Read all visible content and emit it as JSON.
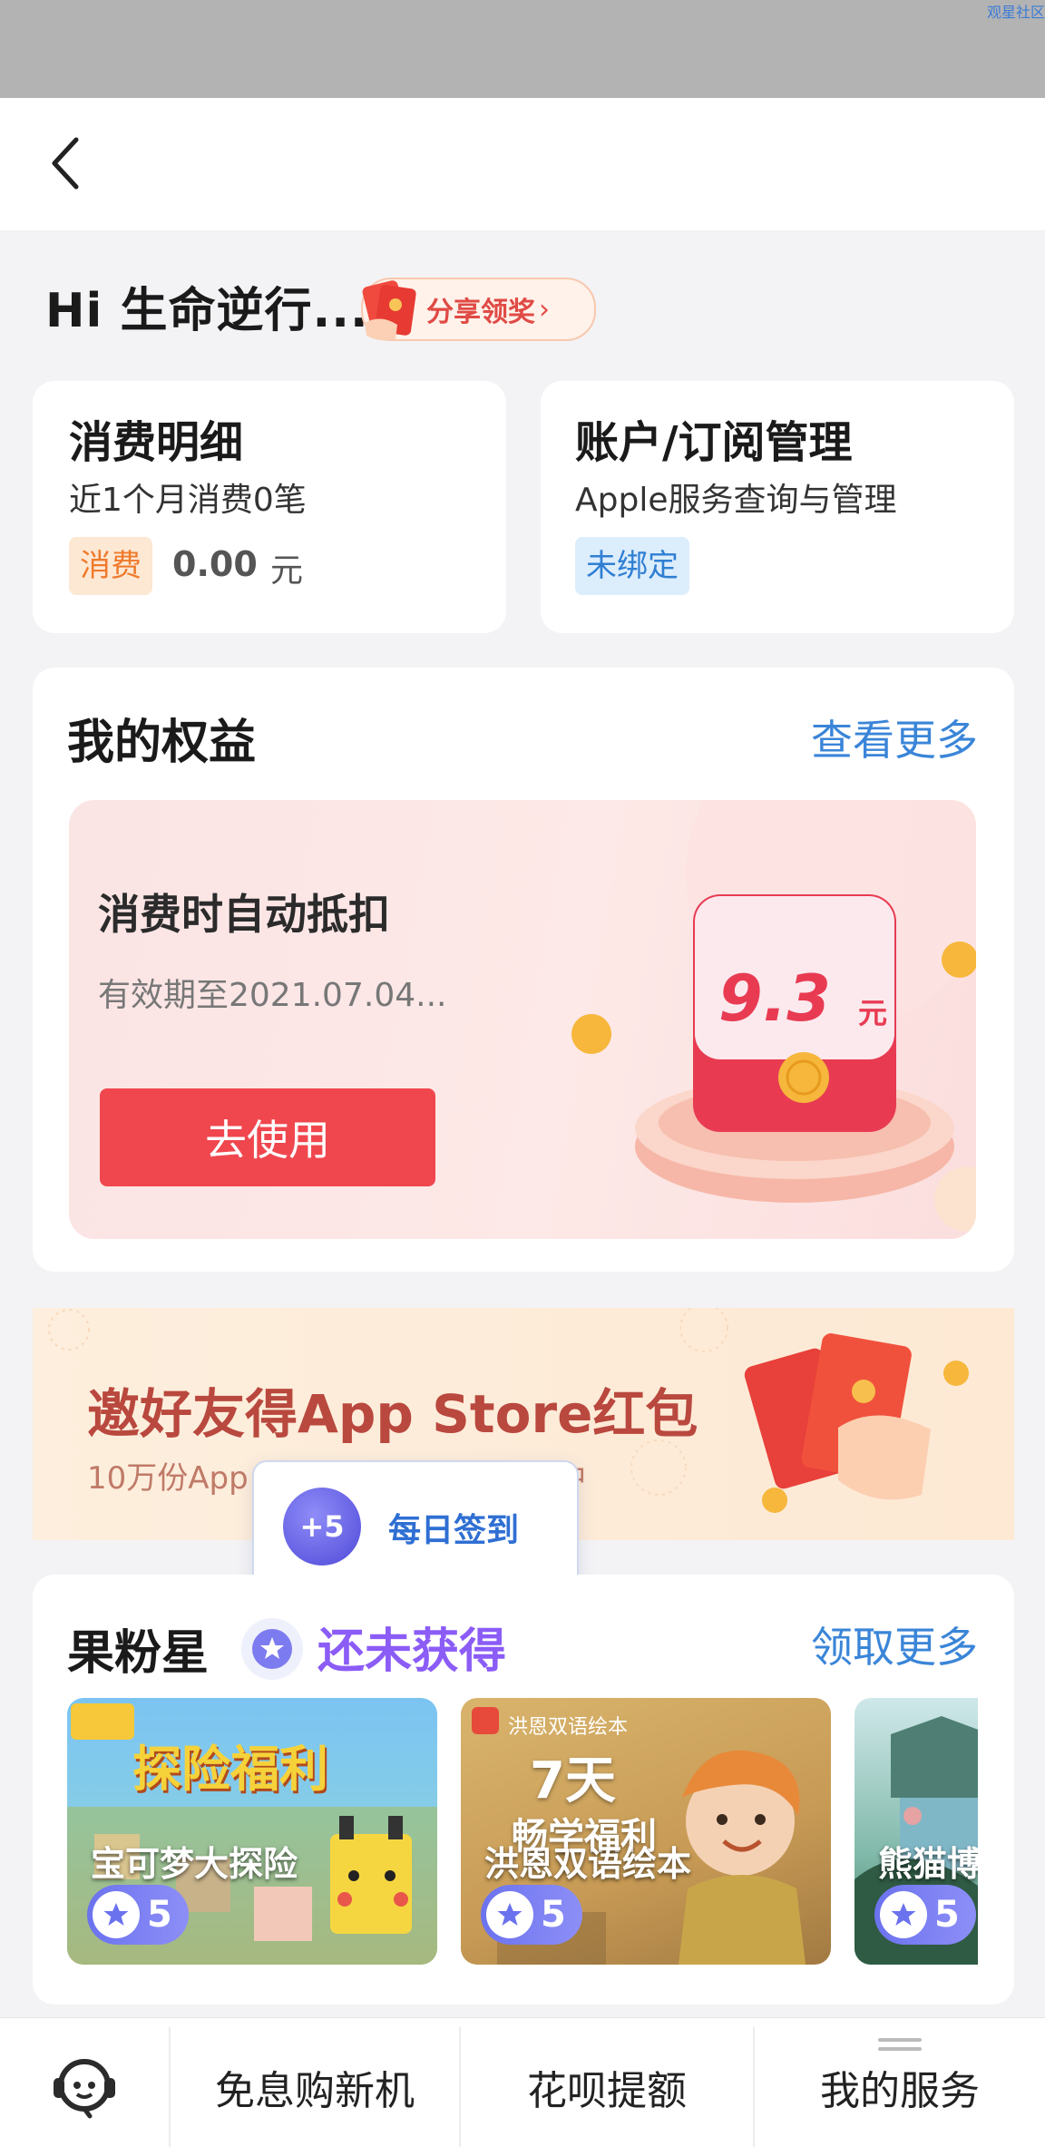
{
  "status": {
    "corner_text": "观星社区"
  },
  "nav": {
    "back_icon": "back-chevron-icon"
  },
  "greeting": {
    "text": "Hi 生命逆行...",
    "share_label": "分享领奖"
  },
  "spending": {
    "title": "消费明细",
    "subtitle": "近1个月消费0笔",
    "tag": "消费",
    "amount": "0.00",
    "unit": "元"
  },
  "account": {
    "title": "账户/订阅管理",
    "subtitle": "Apple服务查询与管理",
    "tag": "未绑定"
  },
  "benefits": {
    "title": "我的权益",
    "more": "查看更多",
    "card_title": "消费时自动抵扣",
    "validity": "有效期至2021.07.04...",
    "button": "去使用",
    "amount": "9.3",
    "unit": "元"
  },
  "invite_banner": {
    "title": "邀好友得App Store红包",
    "subtitle": "10万份App Store无门槛红包派发中"
  },
  "checkin": {
    "points": "+5",
    "label": "每日签到"
  },
  "star": {
    "title": "果粉星",
    "status": "还未获得",
    "more": "领取更多",
    "games": [
      {
        "name": "宝可梦大探险",
        "banner": "探险福利",
        "points": "5"
      },
      {
        "name": "洪恩双语绘本",
        "banner": "7天",
        "banner2": "畅学福利",
        "tag": "洪恩双语绘本",
        "points": "5"
      },
      {
        "name": "熊猫博",
        "points": "5"
      }
    ]
  },
  "bottom_bar": {
    "service_icon": "customer-service-icon",
    "items": [
      "免息购新机",
      "花呗提额",
      "我的服务"
    ]
  },
  "colors": {
    "accent_blue": "#3a85d8",
    "red": "#f0474e",
    "purple": "#8b5cf6"
  }
}
